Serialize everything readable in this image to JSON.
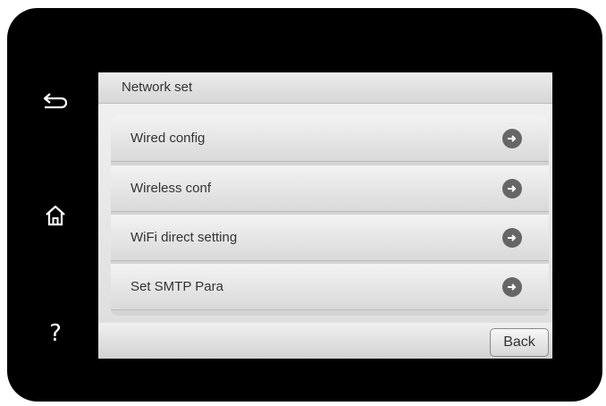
{
  "screen": {
    "title": "Network set"
  },
  "side_buttons": [
    {
      "icon": "back-arrow-icon"
    },
    {
      "icon": "home-icon"
    },
    {
      "icon": "help-icon",
      "glyph": "?"
    }
  ],
  "menu": {
    "items": [
      {
        "label": "Wired config",
        "icon": "arrow-right-icon"
      },
      {
        "label": "Wireless conf",
        "icon": "arrow-right-icon"
      },
      {
        "label": "WiFi direct setting",
        "icon": "arrow-right-icon"
      },
      {
        "label": "Set SMTP Para",
        "icon": "arrow-right-icon"
      }
    ]
  },
  "footer": {
    "back_label": "Back"
  },
  "colors": {
    "bezel": "#000000",
    "screen_bg": "#e6e6e6",
    "arrow_button": "#666666",
    "text": "#333333"
  }
}
